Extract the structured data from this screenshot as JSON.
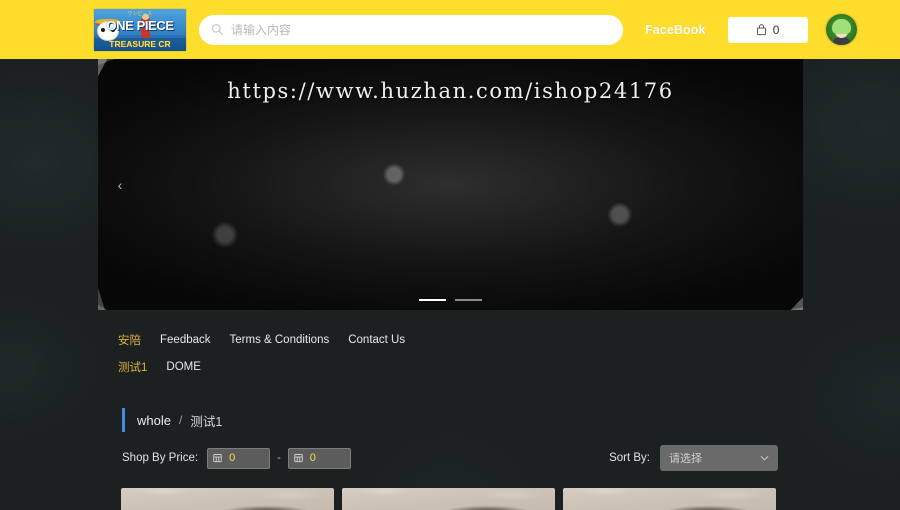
{
  "header": {
    "logo": {
      "name": "one-piece-treasure-cruise-logo",
      "title": "ONE PIECE",
      "subtitle": "TREASURE CR",
      "tiny": "ワンピース"
    },
    "search": {
      "placeholder": "请输入内容",
      "value": "",
      "icon": "search-icon"
    },
    "facebook_label": "FaceBook",
    "cart": {
      "icon": "cart-icon",
      "count": "0"
    },
    "avatar": {
      "name": "user-avatar"
    },
    "background_color": "#ffdd2d"
  },
  "hero": {
    "watermark": "https://www.huzhan.com/ishop24176",
    "prev_arrow": "‹",
    "dots": [
      {
        "active": true
      },
      {
        "active": false
      }
    ]
  },
  "nav": {
    "row1": [
      {
        "label": "安陪",
        "highlight": true
      },
      {
        "label": "Feedback",
        "highlight": false
      },
      {
        "label": "Terms & Conditions",
        "highlight": false
      },
      {
        "label": "Contact Us",
        "highlight": false
      }
    ],
    "row2": [
      {
        "label": "测试1",
        "highlight": true
      },
      {
        "label": "DOME",
        "highlight": false
      }
    ]
  },
  "breadcrumb": {
    "root": "whole",
    "separator": "/",
    "current": "测试1",
    "accent_color": "#3d8ee0"
  },
  "filters": {
    "price_label": "Shop By Price:",
    "price_min": "0",
    "price_max": "0",
    "price_icon": "currency-icon",
    "range_dash": "-",
    "sort_label": "Sort By:",
    "sort_value": "请选择",
    "sort_chevron": "chevron-down-icon"
  },
  "products": [
    {
      "name": "product-card-1"
    },
    {
      "name": "product-card-2"
    },
    {
      "name": "product-card-3"
    }
  ]
}
